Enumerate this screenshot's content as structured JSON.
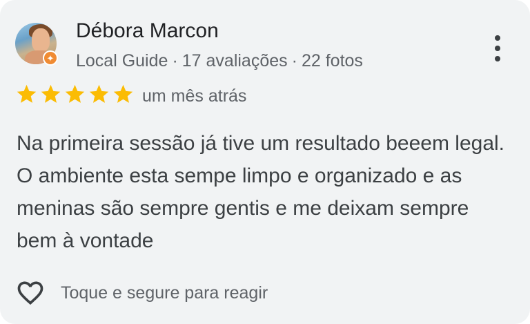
{
  "review": {
    "author_name": "Débora Marcon",
    "author_meta": {
      "badge": "Local Guide",
      "separator": "·",
      "reviews_count": "17 avaliações",
      "photos_count": "22 fotos"
    },
    "rating": 5,
    "rating_max": 5,
    "time_ago": "um mês atrás",
    "text": "Na primeira sessão já tive um resultado beeem legal. O ambiente esta sempe limpo e organizado e as meninas são sempre gentis e me deixam sempre bem à vontade",
    "react_label": "Toque e segure para reagir"
  },
  "icons": {
    "star": "star-icon",
    "heart": "heart-outline-icon",
    "more": "more-vert-icon",
    "guide_badge": "local-guide-badge-icon"
  },
  "colors": {
    "card_bg": "#f1f3f4",
    "star": "#fbbc04",
    "guide_badge": "#f08b33",
    "text_primary": "#202124",
    "text_secondary": "#5f6368"
  }
}
